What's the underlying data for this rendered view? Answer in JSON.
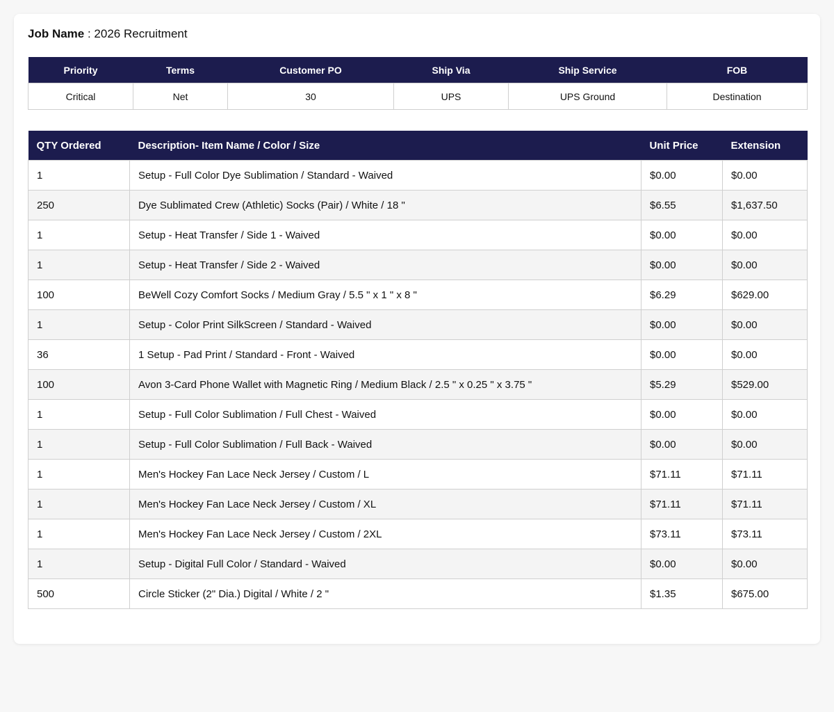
{
  "job": {
    "label": "Job Name",
    "separator": " : ",
    "value": "2026 Recruitment"
  },
  "meta": {
    "headers": [
      "Priority",
      "Terms",
      "Customer PO",
      "Ship Via",
      "Ship Service",
      "FOB"
    ],
    "values": [
      "Critical",
      "Net",
      "30",
      "UPS",
      "UPS Ground",
      "Destination"
    ]
  },
  "items": {
    "headers": [
      "QTY Ordered",
      "Description- Item Name / Color / Size",
      "Unit Price",
      "Extension"
    ],
    "rows": [
      {
        "qty": "1",
        "description": "Setup - Full Color Dye Sublimation / Standard - Waived",
        "unit_price": "$0.00",
        "extension": "$0.00"
      },
      {
        "qty": "250",
        "description": "Dye Sublimated Crew (Athletic) Socks (Pair) / White / 18 \"",
        "unit_price": "$6.55",
        "extension": "$1,637.50"
      },
      {
        "qty": "1",
        "description": "Setup - Heat Transfer / Side 1 - Waived",
        "unit_price": "$0.00",
        "extension": "$0.00"
      },
      {
        "qty": "1",
        "description": "Setup - Heat Transfer / Side 2 - Waived",
        "unit_price": "$0.00",
        "extension": "$0.00"
      },
      {
        "qty": "100",
        "description": "BeWell Cozy Comfort Socks / Medium Gray / 5.5 \" x 1 \" x 8 \"",
        "unit_price": "$6.29",
        "extension": "$629.00"
      },
      {
        "qty": "1",
        "description": "Setup - Color Print SilkScreen / Standard - Waived",
        "unit_price": "$0.00",
        "extension": "$0.00"
      },
      {
        "qty": "36",
        "description": "1 Setup - Pad Print / Standard - Front - Waived",
        "unit_price": "$0.00",
        "extension": "$0.00"
      },
      {
        "qty": "100",
        "description": "Avon 3-Card Phone Wallet with Magnetic Ring / Medium Black / 2.5 \" x 0.25 \" x 3.75 \"",
        "unit_price": "$5.29",
        "extension": "$529.00"
      },
      {
        "qty": "1",
        "description": "Setup - Full Color Sublimation / Full Chest - Waived",
        "unit_price": "$0.00",
        "extension": "$0.00"
      },
      {
        "qty": "1",
        "description": "Setup - Full Color Sublimation / Full Back - Waived",
        "unit_price": "$0.00",
        "extension": "$0.00"
      },
      {
        "qty": "1",
        "description": "Men's Hockey Fan Lace Neck Jersey / Custom / L",
        "unit_price": "$71.11",
        "extension": "$71.11"
      },
      {
        "qty": "1",
        "description": "Men's Hockey Fan Lace Neck Jersey / Custom / XL",
        "unit_price": "$71.11",
        "extension": "$71.11"
      },
      {
        "qty": "1",
        "description": "Men's Hockey Fan Lace Neck Jersey / Custom / 2XL",
        "unit_price": "$73.11",
        "extension": "$73.11"
      },
      {
        "qty": "1",
        "description": "Setup - Digital Full Color / Standard - Waived",
        "unit_price": "$0.00",
        "extension": "$0.00"
      },
      {
        "qty": "500",
        "description": "Circle Sticker (2\" Dia.) Digital / White / 2 \"",
        "unit_price": "$1.35",
        "extension": "$675.00"
      }
    ]
  },
  "colors": {
    "header_bg": "#1c1c4e",
    "header_text": "#ffffff",
    "stripe": "#f4f4f4",
    "border": "#cfcfcf"
  }
}
